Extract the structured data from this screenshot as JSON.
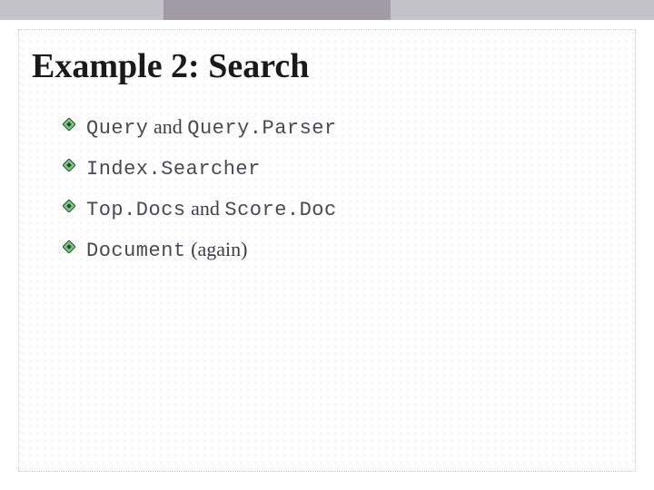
{
  "title": "Example 2: Search",
  "bullets": [
    {
      "parts": [
        {
          "text": "Query",
          "style": "mono"
        },
        {
          "text": " and ",
          "style": "norm"
        },
        {
          "text": "Query.Parser",
          "style": "mono"
        }
      ]
    },
    {
      "parts": [
        {
          "text": "Index.Searcher",
          "style": "mono"
        }
      ]
    },
    {
      "parts": [
        {
          "text": "Top.Docs",
          "style": "mono"
        },
        {
          "text": " and ",
          "style": "norm"
        },
        {
          "text": "Score.Doc",
          "style": "mono"
        }
      ]
    },
    {
      "parts": [
        {
          "text": "Document",
          "style": "mono"
        },
        {
          "text": " (again)",
          "style": "norm"
        }
      ]
    }
  ]
}
